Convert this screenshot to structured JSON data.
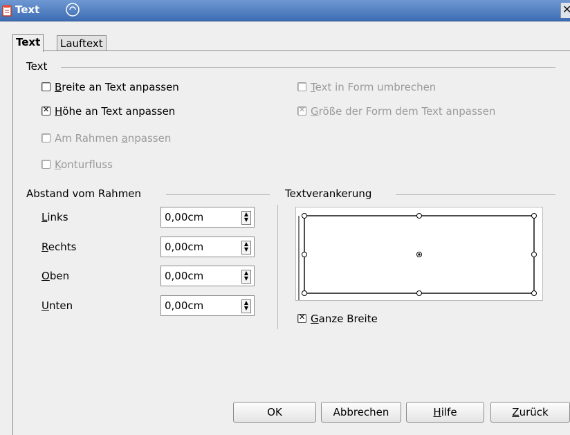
{
  "window": {
    "title": "Text"
  },
  "tabs": [
    {
      "label": "Text"
    },
    {
      "label": "Lauftext"
    }
  ],
  "text_section": {
    "title": "Text",
    "fit_width": {
      "pre": "",
      "ul": "B",
      "post": "reite an Text anpassen"
    },
    "fit_height": {
      "pre": "",
      "ul": "H",
      "post": "öhe an Text anpassen"
    },
    "fit_frame": {
      "pre": "Am Rahmen ",
      "ul": "a",
      "post": "npassen"
    },
    "contour": {
      "pre": "",
      "ul": "K",
      "post": "onturfluss"
    },
    "word_wrap": {
      "pre": "",
      "ul": "T",
      "post": "ext in Form umbrechen"
    },
    "resize_shape": {
      "pre": "",
      "ul": "G",
      "post": "röße der Form dem Text anpassen"
    }
  },
  "spacing_section": {
    "title": "Abstand vom Rahmen",
    "left": {
      "ul": "L",
      "post": "inks",
      "value": "0,00cm"
    },
    "right": {
      "ul": "R",
      "post": "echts",
      "value": "0,00cm"
    },
    "top": {
      "ul": "O",
      "post": "ben",
      "value": "0,00cm"
    },
    "bottom": {
      "ul": "U",
      "post": "nten",
      "value": "0,00cm"
    }
  },
  "anchor_section": {
    "title": "Textverankerung",
    "full_width": {
      "ul": "G",
      "post": "anze Breite"
    }
  },
  "buttons": {
    "ok": "OK",
    "cancel": "Abbrechen",
    "help": {
      "ul": "H",
      "post": "ilfe"
    },
    "back": {
      "ul": "Z",
      "post": "urück"
    }
  },
  "colors": {
    "titlebar": "#3e6db4",
    "disabled_text": "#9a9a9a"
  }
}
